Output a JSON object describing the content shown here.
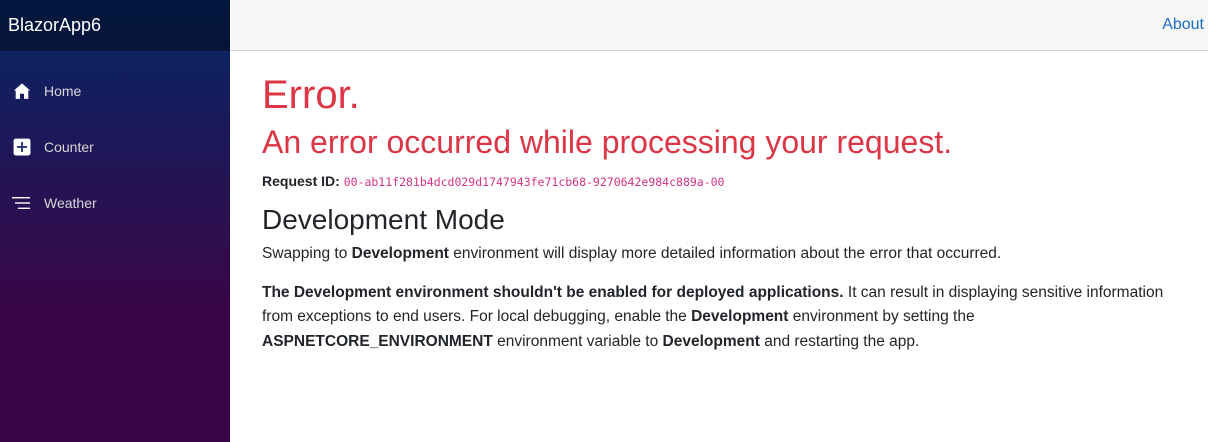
{
  "app": {
    "brand": "BlazorApp6"
  },
  "sidebar": {
    "items": [
      {
        "label": "Home",
        "icon": "home-icon"
      },
      {
        "label": "Counter",
        "icon": "plus-square-icon"
      },
      {
        "label": "Weather",
        "icon": "list-icon"
      }
    ]
  },
  "header": {
    "about_link": "About"
  },
  "error": {
    "title": "Error.",
    "subtitle": "An error occurred while processing your request.",
    "request_id_label": "Request ID:",
    "request_id": "00-ab11f281b4dcd029d1747943fe71cb68-9270642e984c889a-00"
  },
  "dev": {
    "title": "Development Mode",
    "p1": {
      "a": "Swapping to ",
      "b": "Development",
      "c": " environment will display more detailed information about the error that occurred."
    },
    "p2": {
      "a": "The Development environment shouldn't be enabled for deployed applications.",
      "b": " It can result in displaying sensitive information from exceptions to end users. For local debugging, enable the ",
      "c": "Development",
      "d": " environment by setting the ",
      "e": "ASPNETCORE_ENVIRONMENT",
      "f": " environment variable to ",
      "g": "Development",
      "h": " and restarting the app."
    }
  },
  "colors": {
    "error": "#dc3545",
    "link": "#1b6ec2",
    "sidebar_top": "#052767",
    "sidebar_bottom": "#3a0647",
    "request_id": "#d63384"
  }
}
